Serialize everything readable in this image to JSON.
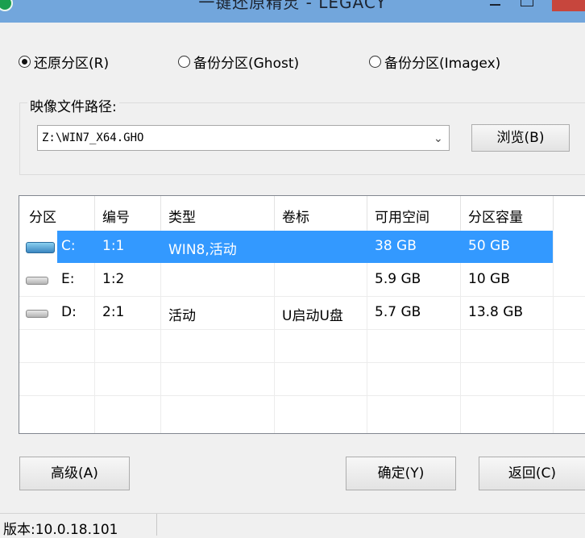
{
  "window": {
    "title": "一键还原精灵 - LEGACY"
  },
  "modes": [
    {
      "label": "还原分区(R)",
      "checked": true
    },
    {
      "label": "备份分区(Ghost)",
      "checked": false
    },
    {
      "label": "备份分区(Imagex)",
      "checked": false
    }
  ],
  "image_group": {
    "label": "映像文件路径:",
    "path_value": "Z:\\WIN7_X64.GHO",
    "browse_label": "浏览(B)"
  },
  "table": {
    "columns": [
      "分区",
      "编号",
      "类型",
      "卷标",
      "可用空间",
      "分区容量"
    ],
    "rows": [
      {
        "drive": "C:",
        "num": "1:1",
        "type": "WIN8,活动",
        "label": "",
        "free": "38 GB",
        "size": "50 GB",
        "selected": true,
        "icon": "system-drive-icon"
      },
      {
        "drive": "E:",
        "num": "1:2",
        "type": "",
        "label": "",
        "free": "5.9 GB",
        "size": "10 GB",
        "selected": false,
        "icon": "drive-icon"
      },
      {
        "drive": "D:",
        "num": "2:1",
        "type": "活动",
        "label": "U启动U盘",
        "free": "5.7 GB",
        "size": "13.8 GB",
        "selected": false,
        "icon": "drive-icon"
      }
    ]
  },
  "buttons": {
    "advanced": "高级(A)",
    "ok": "确定(Y)",
    "back": "返回(C)"
  },
  "status": {
    "version": "版本:10.0.18.101"
  }
}
